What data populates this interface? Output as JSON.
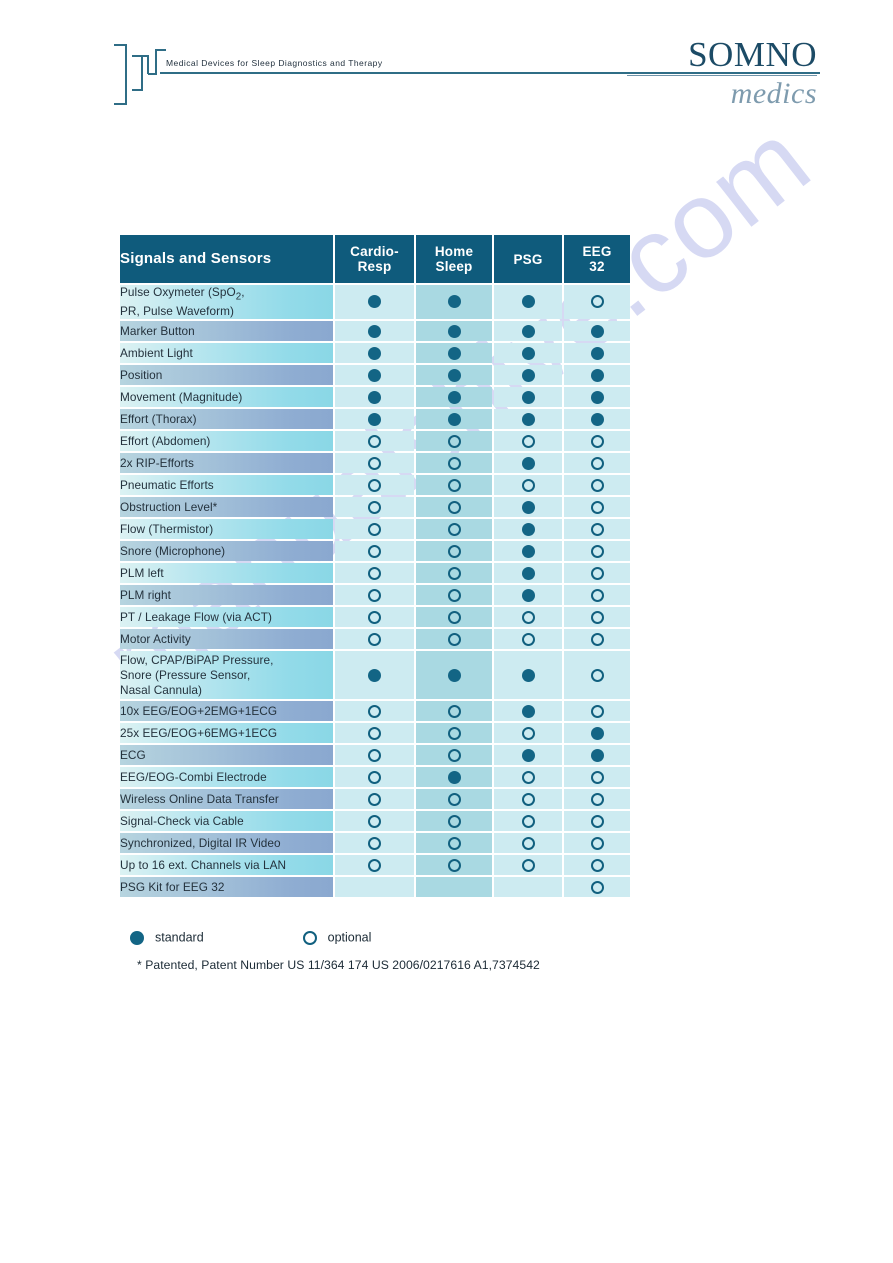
{
  "header": {
    "tagline": "Medical Devices for Sleep Diagnostics and Therapy",
    "brand_top": "SOMNO",
    "brand_bottom": "medics",
    "logo_icon": "waveform-bars-icon"
  },
  "watermark": {
    "text": "manualshive.com"
  },
  "table": {
    "title": "Signals and Sensors",
    "columns": [
      {
        "label": "Cardio-\nResp",
        "line1": "Cardio-",
        "line2": "Resp"
      },
      {
        "label": "Home\nSleep",
        "line1": "Home",
        "line2": "Sleep"
      },
      {
        "label": "PSG",
        "line1": "PSG",
        "line2": ""
      },
      {
        "label": "EEG\n32",
        "line1": "EEG",
        "line2": "32"
      }
    ],
    "rows": [
      {
        "label": "Pulse Oxymeter (SpO₂,\nPR, Pulse Waveform)",
        "label_html": "Pulse Oxymeter (SpO<sub>2</sub>,<br>PR, Pulse Waveform)",
        "values": [
          "standard",
          "standard",
          "standard",
          "optional"
        ],
        "height": "r1"
      },
      {
        "label": "Marker Button",
        "values": [
          "standard",
          "standard",
          "standard",
          "standard"
        ],
        "height": "r2"
      },
      {
        "label": "Ambient Light",
        "values": [
          "standard",
          "standard",
          "standard",
          "standard"
        ],
        "height": "r2"
      },
      {
        "label": "Position",
        "values": [
          "standard",
          "standard",
          "standard",
          "standard"
        ],
        "height": "r2"
      },
      {
        "label": "Movement (Magnitude)",
        "values": [
          "standard",
          "standard",
          "standard",
          "standard"
        ],
        "height": "r2"
      },
      {
        "label": "Effort (Thorax)",
        "values": [
          "standard",
          "standard",
          "standard",
          "standard"
        ],
        "height": "r2"
      },
      {
        "label": "Effort (Abdomen)",
        "values": [
          "optional",
          "optional",
          "optional",
          "optional"
        ],
        "height": "r2"
      },
      {
        "label": "2x RIP-Efforts",
        "values": [
          "optional",
          "optional",
          "standard",
          "optional"
        ],
        "height": "r2"
      },
      {
        "label": "Pneumatic Efforts",
        "values": [
          "optional",
          "optional",
          "optional",
          "optional"
        ],
        "height": "r2"
      },
      {
        "label": "Obstruction Level*",
        "values": [
          "optional",
          "optional",
          "standard",
          "optional"
        ],
        "height": "r2"
      },
      {
        "label": "Flow (Thermistor)",
        "values": [
          "optional",
          "optional",
          "standard",
          "optional"
        ],
        "height": "r2"
      },
      {
        "label": "Snore (Microphone)",
        "values": [
          "optional",
          "optional",
          "standard",
          "optional"
        ],
        "height": "r2"
      },
      {
        "label": "PLM left",
        "values": [
          "optional",
          "optional",
          "standard",
          "optional"
        ],
        "height": "r2"
      },
      {
        "label": "PLM right",
        "values": [
          "optional",
          "optional",
          "standard",
          "optional"
        ],
        "height": "r2"
      },
      {
        "label": "PT / Leakage Flow (via ACT)",
        "values": [
          "optional",
          "optional",
          "optional",
          "optional"
        ],
        "height": "r2"
      },
      {
        "label": "Motor Activity",
        "values": [
          "optional",
          "optional",
          "optional",
          "optional"
        ],
        "height": "r2"
      },
      {
        "label": "Flow, CPAP/BiPAP Pressure,\nSnore (Pressure Sensor,\nNasal Cannula)",
        "label_html": "Flow, CPAP/BiPAP Pressure,<br>Snore (Pressure Sensor,<br>Nasal Cannula)",
        "values": [
          "standard",
          "standard",
          "standard",
          "optional"
        ],
        "height": "r3"
      },
      {
        "label": "10x EEG/EOG+2EMG+1ECG",
        "values": [
          "optional",
          "optional",
          "standard",
          "optional"
        ],
        "height": "r2"
      },
      {
        "label": "25x EEG/EOG+6EMG+1ECG",
        "values": [
          "optional",
          "optional",
          "optional",
          "standard"
        ],
        "height": "r2"
      },
      {
        "label": "ECG",
        "values": [
          "optional",
          "optional",
          "standard",
          "standard"
        ],
        "height": "r2"
      },
      {
        "label": "EEG/EOG-Combi Electrode",
        "values": [
          "optional",
          "standard",
          "optional",
          "optional"
        ],
        "height": "r2"
      },
      {
        "label": "Wireless Online Data Transfer",
        "values": [
          "optional",
          "optional",
          "optional",
          "optional"
        ],
        "height": "r2"
      },
      {
        "label": "Signal-Check via Cable",
        "values": [
          "optional",
          "optional",
          "optional",
          "optional"
        ],
        "height": "r2"
      },
      {
        "label": "Synchronized, Digital IR Video",
        "values": [
          "optional",
          "optional",
          "optional",
          "optional"
        ],
        "height": "r2"
      },
      {
        "label": "Up to 16 ext. Channels via LAN",
        "values": [
          "optional",
          "optional",
          "optional",
          "optional"
        ],
        "height": "r2"
      },
      {
        "label": "PSG Kit for EEG 32",
        "values": [
          "none",
          "none",
          "none",
          "optional"
        ],
        "height": "rlast"
      }
    ]
  },
  "legend": {
    "standard_label": "standard",
    "optional_label": "optional"
  },
  "footnote": {
    "text": "* Patented, Patent Number US 11/364 174 US 2006/0217616 A1,7374542"
  },
  "colors": {
    "header_bg": "#0f5b7c",
    "dot": "#136585",
    "brand_dark": "#1c4b66",
    "brand_light": "#7e9bae",
    "row_odd_left": "#dcf2f3",
    "row_odd_right": "#8ad7e6",
    "row_even_left": "#b6d4df",
    "row_even_right": "#8aa8cf",
    "cell_light": "#cdebf1",
    "cell_mid": "#a9d9e2",
    "watermark": "#7882d7"
  }
}
